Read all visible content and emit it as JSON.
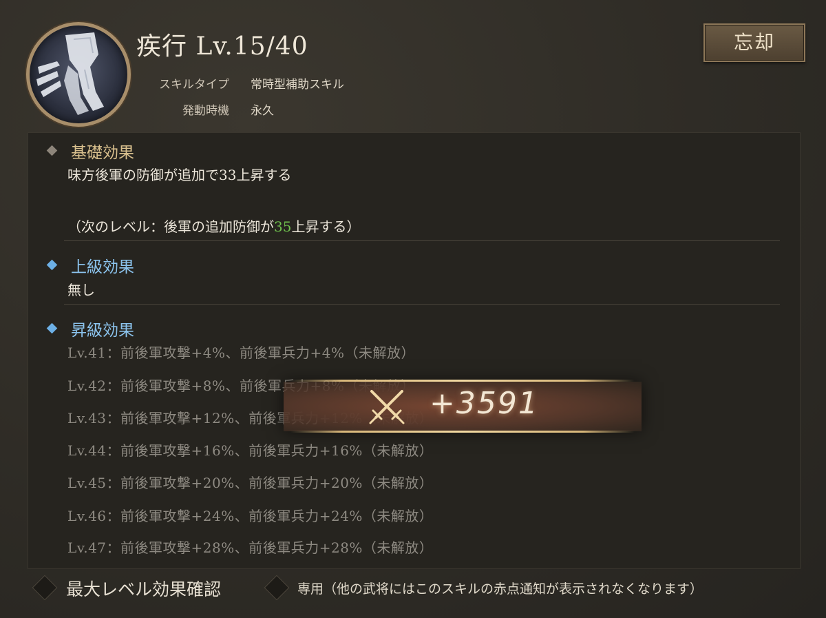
{
  "header": {
    "title": "疾行 Lv.15/40",
    "skill_type_label": "スキルタイプ",
    "skill_type_value": "常時型補助スキル",
    "trigger_label": "発動時機",
    "trigger_value": "永久",
    "forget_button": "忘却"
  },
  "basic": {
    "heading": "基礎効果",
    "text": "味方後軍の防御が追加で33上昇する",
    "next_prefix": "（次のレベル：後軍の追加防御が",
    "next_value": "35",
    "next_suffix": "上昇する）"
  },
  "advanced": {
    "heading": "上級効果",
    "text": "無し"
  },
  "upgrade": {
    "heading": "昇級効果",
    "rows": [
      "Lv.41：前後軍攻撃+4%、前後軍兵力+4%（未解放）",
      "Lv.42：前後軍攻撃+8%、前後軍兵力+8%（未解放）",
      "Lv.43：前後軍攻撃+12%、前後軍兵力+12%（未解放）",
      "Lv.44：前後軍攻撃+16%、前後軍兵力+16%（未解放）",
      "Lv.45：前後軍攻撃+20%、前後軍兵力+20%（未解放）",
      "Lv.46：前後軍攻撃+24%、前後軍兵力+24%（未解放）",
      "Lv.47：前後軍攻撃+28%、前後軍兵力+28%（未解放）"
    ]
  },
  "popup": {
    "value": "+3591",
    "icon": "crossed-swords-icon"
  },
  "footer": {
    "max_level_check": "最大レベル効果確認",
    "exclusive_note": "専用（他の武将にはこのスキルの赤点通知が表示されなくなります）"
  },
  "colors": {
    "heading_gold": "#d9c08e",
    "heading_blue": "#8cc4ee",
    "next_value_green": "#6fc04d"
  }
}
